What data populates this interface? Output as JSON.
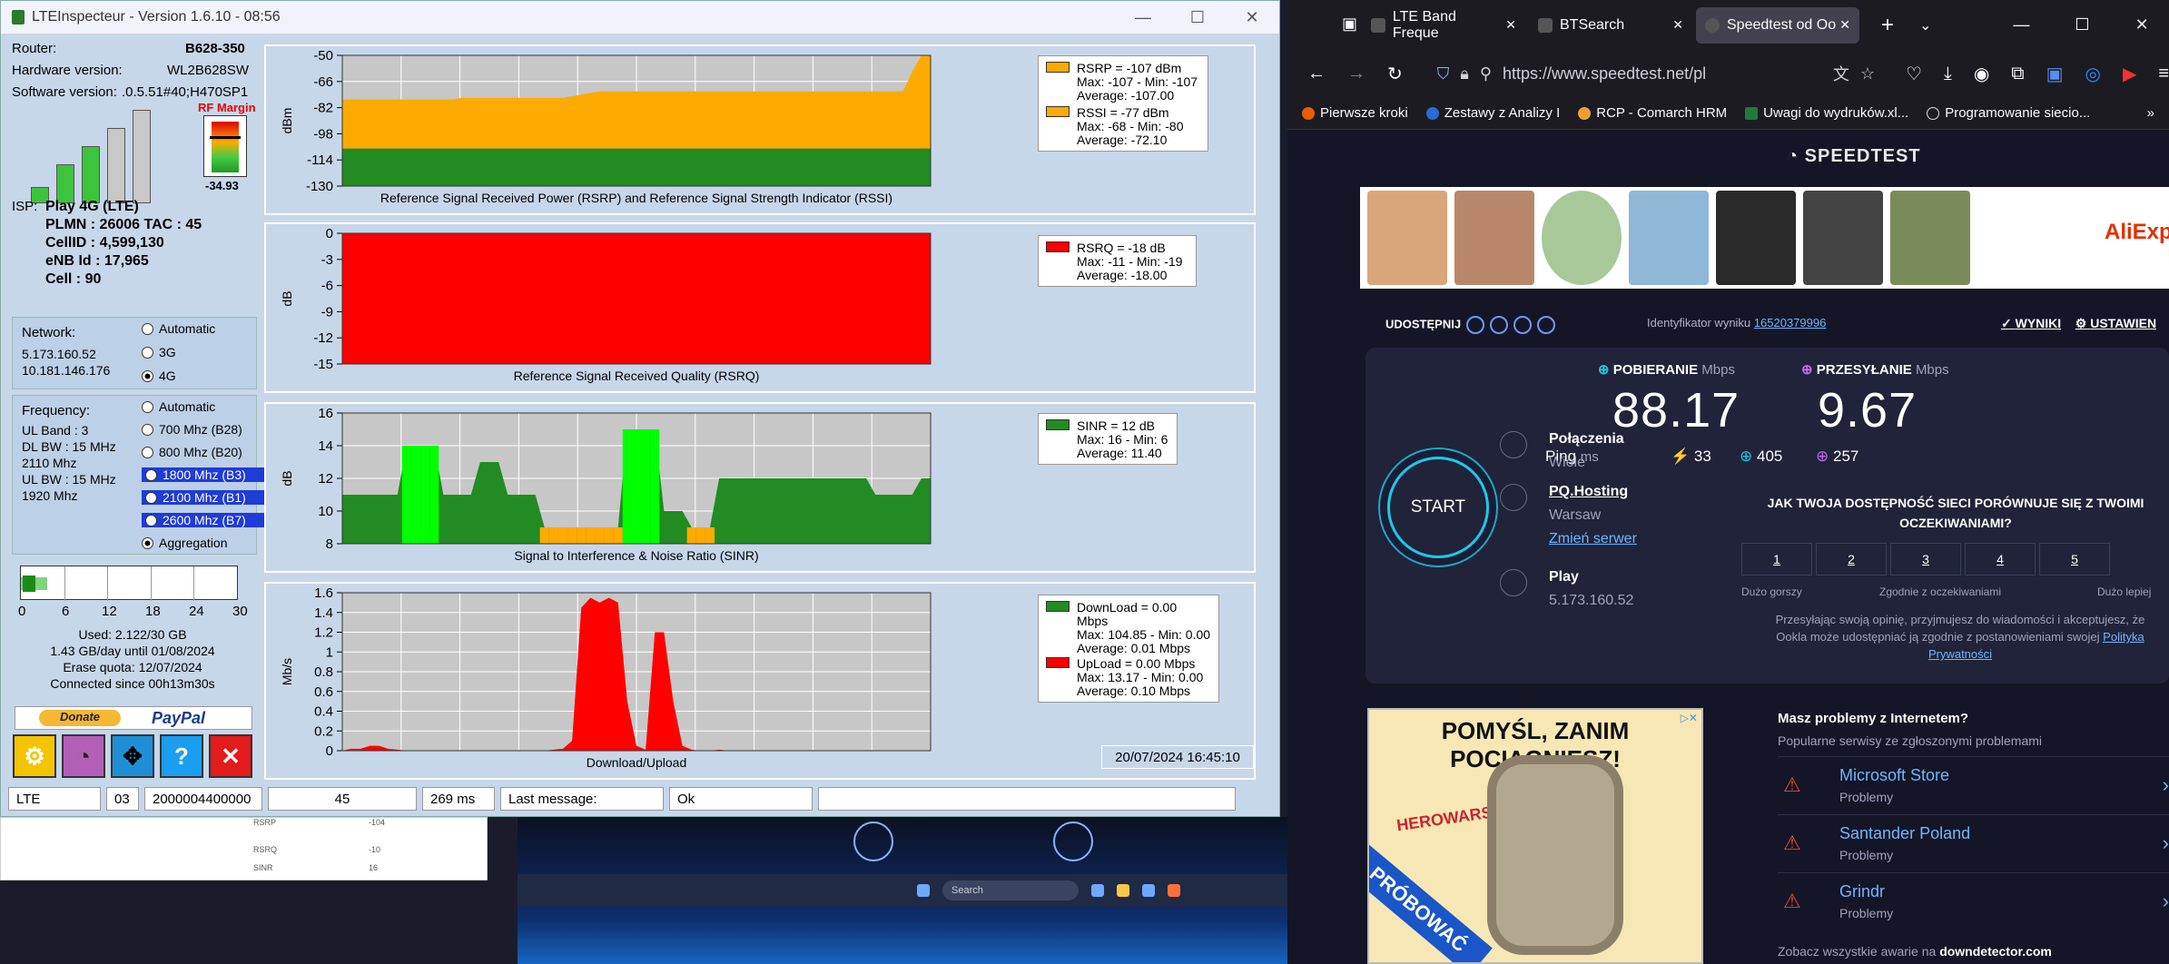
{
  "lte": {
    "title": "LTEInspecteur - Version 1.6.10 - 08:56",
    "router_label": "Router:",
    "router": "B628-350",
    "hw_label": "Hardware version:",
    "hw": "WL2B628SW",
    "sw_label": "Software version:",
    "sw": ".0.5.51#40;H470SP1",
    "rf_margin": "RF Margin",
    "rf_value": "-34.93",
    "isp_label": "ISP:",
    "isp": "Play 4G (LTE)",
    "plmn": "PLMN : 26006 TAC : 45",
    "cellid": "CellID : 4,599,130",
    "enb": "eNB Id : 17,965",
    "cell": "Cell : 90",
    "network_label": "Network:",
    "ip1": "5.173.160.52",
    "ip2": "10.181.146.176",
    "net_options": [
      "Automatic",
      "3G",
      "4G"
    ],
    "freq_label": "Frequency:",
    "ul_band": "UL Band : 3",
    "dl_bw": "DL BW : 15 MHz",
    "dl_freq": "2110 Mhz",
    "ul_bw": "UL BW : 15 MHz",
    "ul_freq": "1920 Mhz",
    "freq_options": [
      "Automatic",
      "700 Mhz (B28)",
      "800 Mhz (B20)",
      "1800 Mhz (B3)",
      "2100 Mhz (B1)",
      "2600 Mhz (B7)",
      "Aggregation"
    ],
    "quota_ticks": [
      "0",
      "6",
      "12",
      "18",
      "24",
      "30"
    ],
    "quota_fill": 0.12,
    "used": "Used: 2.122/30 GB",
    "per_day": "1.43 GB/day until 01/08/2024",
    "erase": "Erase quota: 12/07/2024",
    "connected": "Connected since 00h13m30s",
    "donate": "Donate",
    "paypal": "PayPal",
    "datestamp": "20/07/2024 16:45:10",
    "status": [
      "LTE",
      "03",
      "2000004400000",
      "45",
      "269 ms",
      "Last message:",
      "Ok",
      ""
    ],
    "bg_labels": [
      "RSRP",
      "-104",
      "RSRQ",
      "-10",
      "SINR",
      "16"
    ]
  },
  "chart_data": [
    {
      "type": "area",
      "ylabel": "dBm",
      "xlabel": "Reference Signal Received Power (RSRP) and Reference Signal Strength Indicator (RSSI)",
      "ylim": [
        -130,
        -50
      ],
      "yticks": [
        "-50",
        "-66",
        "-82",
        "-98",
        "-114",
        "-130"
      ],
      "series": [
        {
          "name": "RSSI",
          "color": "#ffaa00",
          "values": [
            -77,
            -77,
            -77,
            -77,
            -77,
            -77,
            -77,
            -77,
            -77,
            -77,
            -77,
            -77,
            -77,
            -76,
            -76,
            -76,
            -76,
            -76,
            -76,
            -76,
            -76,
            -76,
            -76,
            -76,
            -76,
            -75,
            -74,
            -73,
            -72,
            -72,
            -72,
            -72,
            -72,
            -72,
            -72,
            -72,
            -72,
            -72,
            -72,
            -72,
            -72,
            -72,
            -72,
            -72,
            -72,
            -72,
            -72,
            -72,
            -72,
            -72,
            -72,
            -72,
            -72,
            -72,
            -72,
            -72,
            -72,
            -72,
            -72,
            -72,
            -72,
            -72,
            -60,
            -50,
            -50
          ]
        },
        {
          "name": "RSRP",
          "color": "#228b22",
          "values": [
            -107,
            -107,
            -107,
            -107,
            -107,
            -107,
            -107,
            -107,
            -107,
            -107,
            -107,
            -107,
            -107,
            -107,
            -107,
            -107,
            -107,
            -107,
            -107,
            -107,
            -107,
            -107,
            -107,
            -107,
            -107,
            -107,
            -107,
            -107,
            -107,
            -107,
            -107,
            -107,
            -107,
            -107,
            -107,
            -107,
            -107,
            -107,
            -107,
            -107,
            -107,
            -107,
            -107,
            -107,
            -107,
            -107,
            -107,
            -107,
            -107,
            -107,
            -107,
            -107,
            -107,
            -107,
            -107,
            -107,
            -107,
            -107,
            -107,
            -107,
            -107,
            -107,
            -107,
            -107,
            -107
          ]
        }
      ],
      "legend": [
        {
          "color": "#ffaa00",
          "lines": [
            "RSRP = -107 dBm",
            "Max: -107 - Min: -107",
            "Average: -107.00"
          ]
        },
        {
          "color": "#ffaa00",
          "lines": [
            "RSSI = -77 dBm",
            "Max: -68 - Min: -80",
            "Average: -72.10"
          ]
        }
      ]
    },
    {
      "type": "area",
      "ylabel": "dB",
      "xlabel": "Reference Signal Received Quality (RSRQ)",
      "ylim": [
        -15,
        0
      ],
      "yticks": [
        "0",
        "-3",
        "-6",
        "-9",
        "-12",
        "-15"
      ],
      "series": [
        {
          "name": "RSRQ",
          "color": "#ff0000",
          "values": [
            0,
            0,
            0,
            0,
            0,
            0,
            0,
            0,
            0,
            0,
            0,
            0,
            0,
            0,
            0,
            0,
            0,
            0,
            0,
            0,
            0,
            0,
            0,
            0,
            0,
            0,
            0,
            0,
            0,
            0,
            0,
            0,
            0,
            0,
            0,
            0,
            0,
            0,
            0,
            0,
            0,
            0,
            0,
            0,
            0,
            0,
            0,
            0,
            0,
            0,
            0,
            0,
            0,
            0,
            0,
            0,
            0,
            0,
            0,
            0,
            0,
            0,
            0,
            0,
            0
          ]
        }
      ],
      "legend": [
        {
          "color": "#ff0000",
          "lines": [
            "RSRQ = -18 dB",
            "Max: -11 - Min: -19",
            "Average: -18.00"
          ]
        }
      ]
    },
    {
      "type": "area",
      "ylabel": "dB",
      "xlabel": "Signal to Interference & Noise Ratio (SINR)",
      "ylim": [
        8,
        16
      ],
      "yticks": [
        "16",
        "14",
        "12",
        "10",
        "8"
      ],
      "series": [
        {
          "name": "SINR",
          "color": "#228b22",
          "values": [
            11,
            11,
            11,
            11,
            11,
            11,
            11,
            14,
            14,
            14,
            14,
            11,
            11,
            11,
            11,
            13,
            13,
            13,
            11,
            11,
            11,
            11,
            9,
            9,
            9,
            9,
            9,
            9,
            9,
            9,
            9,
            15,
            15,
            15,
            15,
            10,
            10,
            10,
            9,
            9,
            9,
            12,
            12,
            12,
            12,
            12,
            12,
            12,
            12,
            12,
            12,
            12,
            12,
            12,
            12,
            12,
            12,
            12,
            11,
            11,
            11,
            11,
            11,
            12,
            12
          ]
        }
      ],
      "legend": [
        {
          "color": "#228b22",
          "lines": [
            "SINR = 12 dB",
            "Max: 16 - Min: 6",
            "Average: 11.40"
          ]
        }
      ]
    },
    {
      "type": "area",
      "ylabel": "Mb/s",
      "xlabel": "Download/Upload",
      "ylim": [
        0,
        1.6
      ],
      "yticks": [
        "1.6",
        "1.4",
        "1.2",
        "1",
        "0.8",
        "0.6",
        "0.4",
        "0.2",
        "0"
      ],
      "series": [
        {
          "name": "UpLoad",
          "color": "#ff0000",
          "values": [
            0,
            0.02,
            0.02,
            0.05,
            0.05,
            0.02,
            0.01,
            0,
            0,
            0,
            0,
            0,
            0,
            0,
            0,
            0,
            0,
            0,
            0,
            0,
            0,
            0,
            0,
            0.01,
            0.02,
            0.1,
            1.45,
            1.55,
            1.5,
            1.55,
            1.5,
            0.5,
            0.05,
            0.01,
            1.2,
            1.2,
            0.5,
            0.05,
            0.01,
            0,
            0,
            0.01,
            0,
            0,
            0,
            0,
            0,
            0,
            0,
            0,
            0,
            0,
            0,
            0,
            0,
            0,
            0,
            0,
            0,
            0,
            0,
            0,
            0,
            0,
            0
          ]
        }
      ],
      "legend": [
        {
          "color": "#228b22",
          "lines": [
            "DownLoad = 0.00 Mbps",
            "Max: 104.85 - Min: 0.00",
            "Average: 0.01 Mbps"
          ]
        },
        {
          "color": "#ff0000",
          "lines": [
            "UpLoad = 0.00 Mbps",
            "Max: 13.17 - Min: 0.00",
            "Average: 0.10 Mbps"
          ]
        }
      ]
    }
  ],
  "ff": {
    "tabs": [
      "LTE Band Freque",
      "BTSearch",
      "Speedtest od Ookla"
    ],
    "url": "https://www.speedtest.net/pl",
    "bookmarks": [
      "Pierwsze kroki",
      "Zestawy z Analizy I",
      "RCP - Comarch HRM",
      "Uwagi do wydruków.xl...",
      "Programowanie siecio..."
    ],
    "logo": "SPEEDTEST",
    "ad_brand": "AliExpress",
    "share": "UDOSTĘPNIJ",
    "result_id_label": "Identyfikator wyniku",
    "result_id": "16520379996",
    "results": "WYNIKI",
    "settings": "USTAWIEN",
    "download_label": "POBIERANIE",
    "upload_label": "PRZESYŁANIE",
    "unit": "Mbps",
    "download": "88.17",
    "upload": "9.67",
    "ping_label": "Ping",
    "ms": "ms",
    "ping": "33",
    "ping_down": "405",
    "ping_up": "257",
    "start": "START",
    "connections": "Połączenia",
    "connections_val": "Wiele",
    "host": "PQ.Hosting",
    "host_city": "Warsaw",
    "change_server": "Zmień serwer",
    "isp": "Play",
    "isp_ip": "5.173.160.52",
    "survey": "JAK TWOJA DOSTĘPNOŚĆ SIECI PORÓWNUJE SIĘ Z TWOIMI OCZEKIWANIAMI?",
    "ratings": [
      "1",
      "2",
      "3",
      "4",
      "5"
    ],
    "rating_low": "Dużo gorszy",
    "rating_mid": "Zgodnie z oczekiwaniami",
    "rating_high": "Dużo lepiej",
    "disclaimer": "Przesyłając swoją opinię, przyjmujesz do wiadomości i akceptujesz, że Ookla może udostępniać ją zgodnie z postanowieniami swojej",
    "privacy": "Polityka Prywatności",
    "ad2_head": "POMYŚL, ZANIM POCIĄGNIESZ!",
    "ad2_brand": "HEROWARS",
    "ad2_ribbon": "PRÓBOWAĆ",
    "problems_head": "Masz problemy z Internetem?",
    "problems_sub": "Popularne serwisy ze zgłoszonymi problemami",
    "problems": [
      {
        "name": "Microsoft Store",
        "status": "Problemy"
      },
      {
        "name": "Santander Poland",
        "status": "Problemy"
      },
      {
        "name": "Grindr",
        "status": "Problemy"
      }
    ],
    "footer_text": "Zobacz wszystkie awarie na",
    "footer_brand": "downdetector.com"
  },
  "taskbar": {
    "search": "Search"
  }
}
